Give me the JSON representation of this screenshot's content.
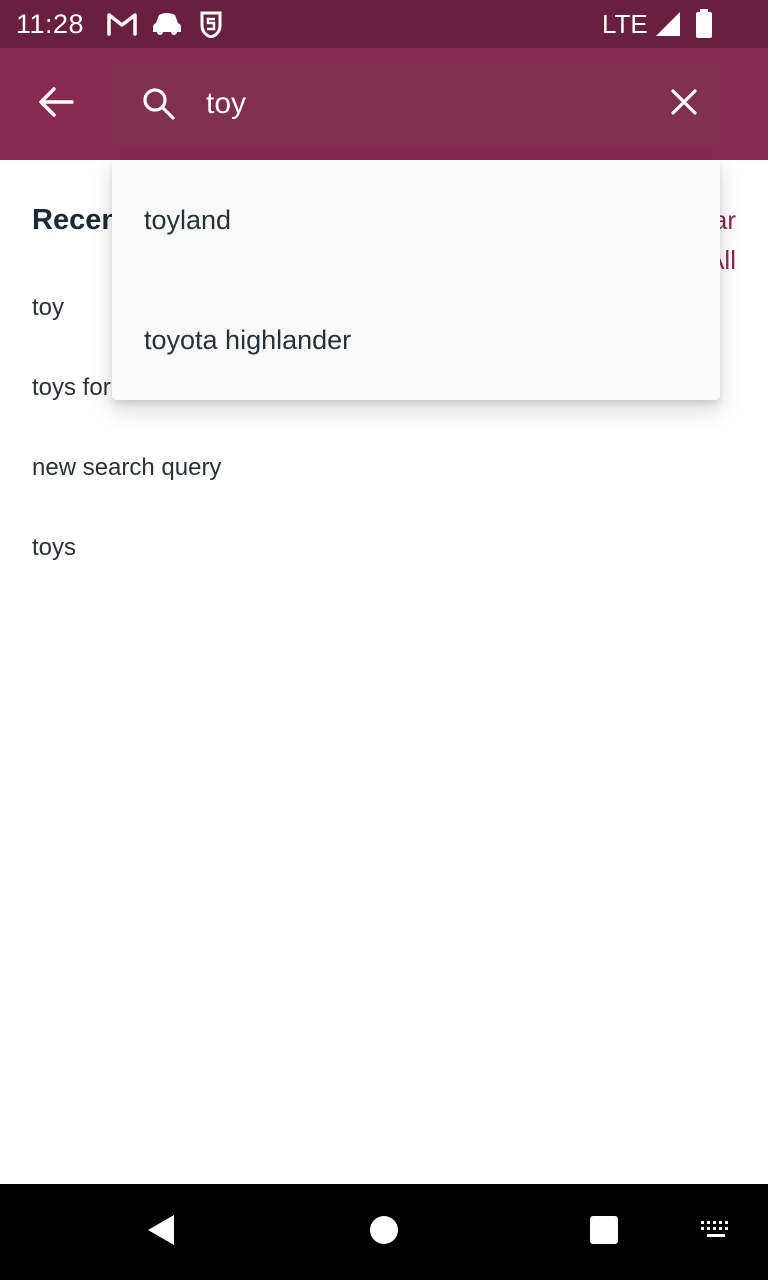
{
  "status_bar": {
    "time": "11:28",
    "network": "LTE",
    "icons": [
      "gmail-icon",
      "car-icon",
      "shield-icon",
      "signal-icon",
      "battery-icon"
    ]
  },
  "search": {
    "query": "toy",
    "placeholder": ""
  },
  "recent": {
    "title": "Recent",
    "clear_all_label": "Clear All",
    "items": [
      "toy",
      "toys for girls",
      "new search query",
      "toys"
    ]
  },
  "suggestions": [
    "toyland",
    "toyota highlander"
  ],
  "colors": {
    "status_bar": "#69203e",
    "app_bar": "#88294f",
    "search_box": "#7f304f",
    "accent": "#88294f",
    "text_dark": "#1b2a33",
    "dropdown_bg": "#f9f9f9"
  }
}
